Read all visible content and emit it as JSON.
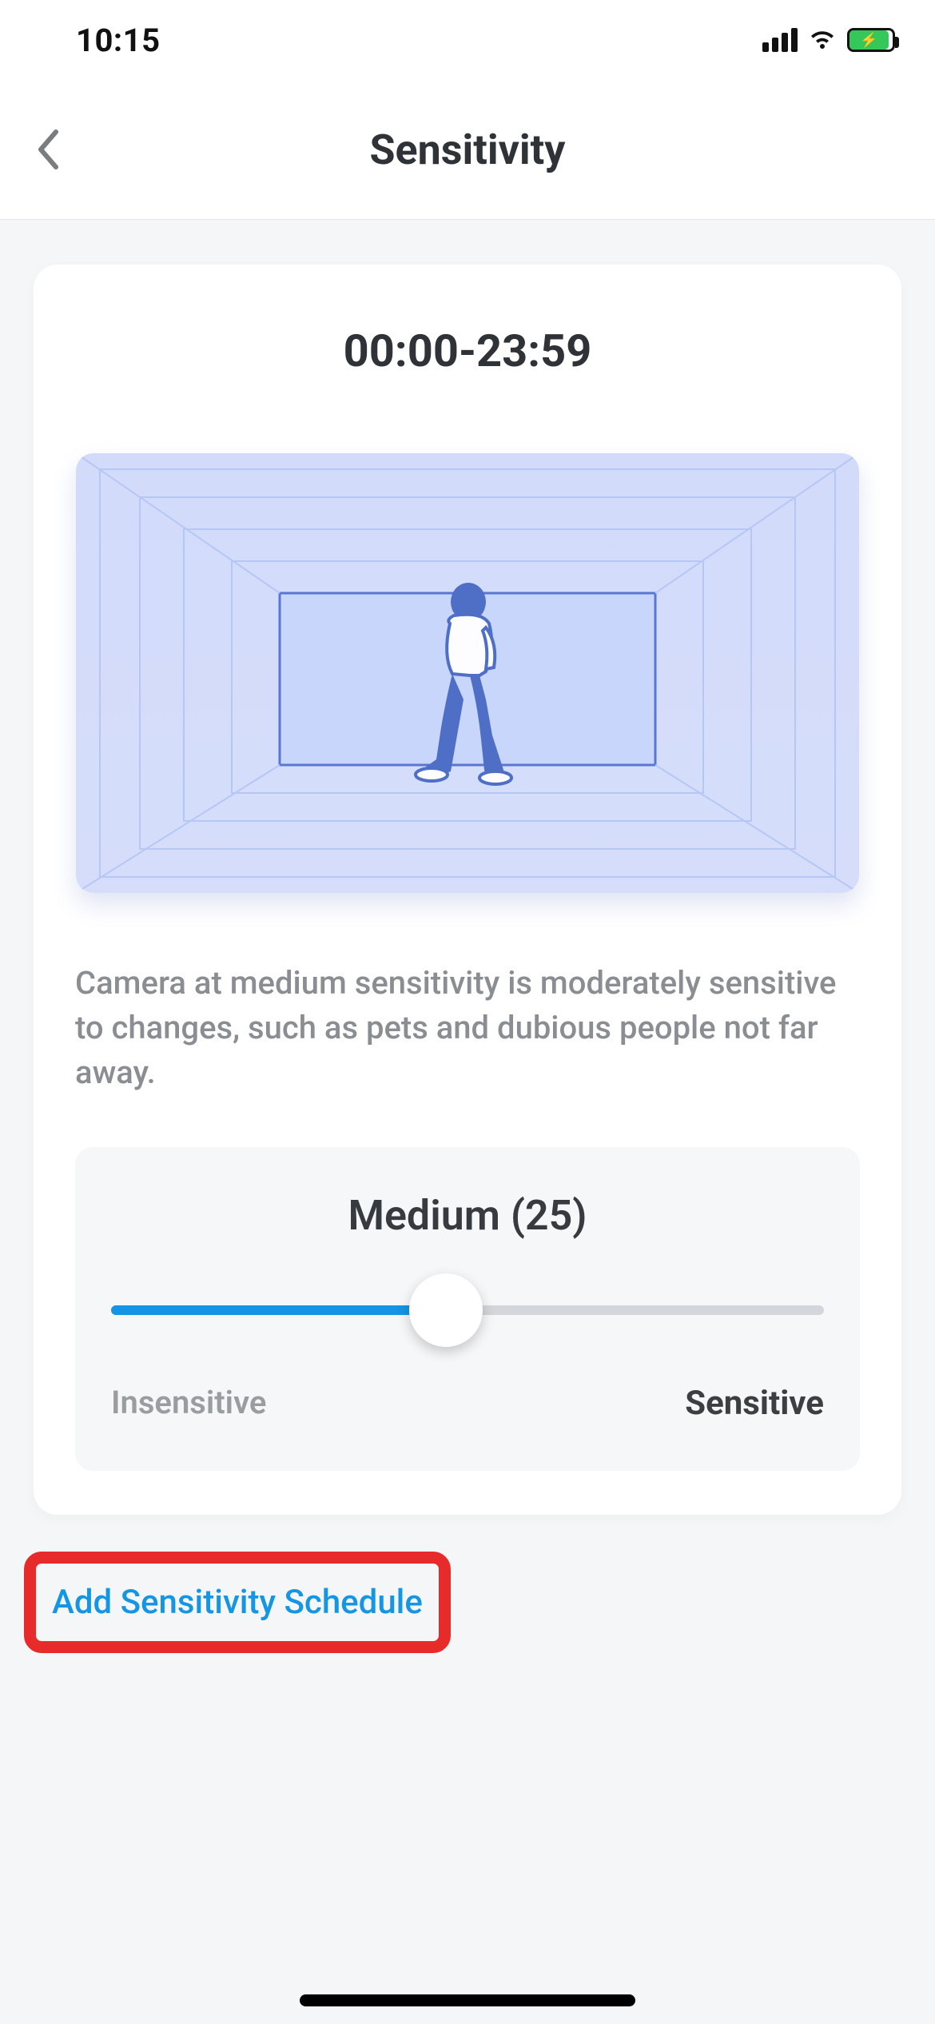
{
  "status": {
    "time": "10:15"
  },
  "nav": {
    "title": "Sensitivity"
  },
  "card": {
    "time_range": "00:00-23:59",
    "description": "Camera at medium sensitivity is moderately sensitive to changes, such as pets and dubious people not far away.",
    "slider": {
      "level_label": "Medium (25)",
      "value": 25,
      "min_label": "Insensitive",
      "max_label": "Sensitive"
    }
  },
  "actions": {
    "add_schedule": "Add Sensitivity Schedule"
  }
}
